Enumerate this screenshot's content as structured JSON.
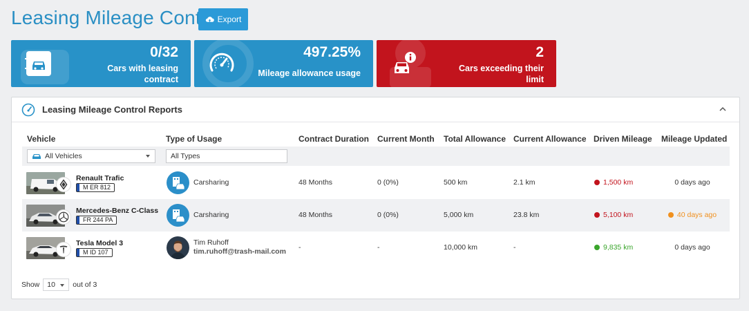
{
  "header": {
    "title": "Leasing Mileage Control",
    "export_label": "Export"
  },
  "stats": [
    {
      "value": "0/32",
      "label_line1": "Cars with leasing",
      "label_line2": "contract",
      "color": "#2892c8",
      "icon": "car-contract-icon"
    },
    {
      "value": "497.25%",
      "label_line1": "Mileage allowance usage",
      "label_line2": "",
      "color": "#2892c8",
      "icon": "speedometer-icon"
    },
    {
      "value": "2",
      "label_line1": "Cars exceeding their",
      "label_line2": "limit",
      "color": "#c2141d",
      "icon": "car-alert-icon"
    }
  ],
  "panel": {
    "title": "Leasing Mileage Control Reports",
    "columns": [
      "Vehicle",
      "Type of Usage",
      "Contract Duration",
      "Current Month",
      "Total Allowance",
      "Current Allowance",
      "Driven Mileage",
      "Mileage Updated"
    ],
    "filters": {
      "vehicle_selected": "All Vehicles",
      "type_value": "All Types"
    },
    "rows": [
      {
        "vehicle": "Renault Trafic",
        "plate": "M ER 812",
        "brand_icon": "renault-logo-icon",
        "usage": "Carsharing",
        "contract_duration": "48 Months",
        "current_month": "0 (0%)",
        "total_allowance": "500 km",
        "current_allowance": "2.1 km",
        "driven_mileage": "1,500 km",
        "mileage_status_color": "#c2141d",
        "mileage_updated": "0 days ago",
        "updated_color": "#333333"
      },
      {
        "vehicle": "Mercedes-Benz C-Class",
        "plate": "FR 244 PA",
        "brand_icon": "mercedes-logo-icon",
        "usage": "Carsharing",
        "contract_duration": "48 Months",
        "current_month": "0 (0%)",
        "total_allowance": "5,000 km",
        "current_allowance": "23.8 km",
        "driven_mileage": "5,100 km",
        "mileage_status_color": "#c2141d",
        "mileage_updated": "40 days ago",
        "updated_color": "#f0901e"
      },
      {
        "vehicle": "Tesla Model 3",
        "plate": "M ID 107",
        "brand_icon": "tesla-logo-icon",
        "user_name": "Tim Ruhoff",
        "user_email": "tim.ruhoff@trash-mail.com",
        "contract_duration": "-",
        "current_month": "-",
        "total_allowance": "10,000 km",
        "current_allowance": "-",
        "driven_mileage": "9,835 km",
        "mileage_status_color": "#3aa52c",
        "mileage_updated": "0 days ago",
        "updated_color": "#333333"
      }
    ],
    "footer": {
      "show_label": "Show",
      "page_size": "10",
      "out_of": "out of 3"
    }
  }
}
